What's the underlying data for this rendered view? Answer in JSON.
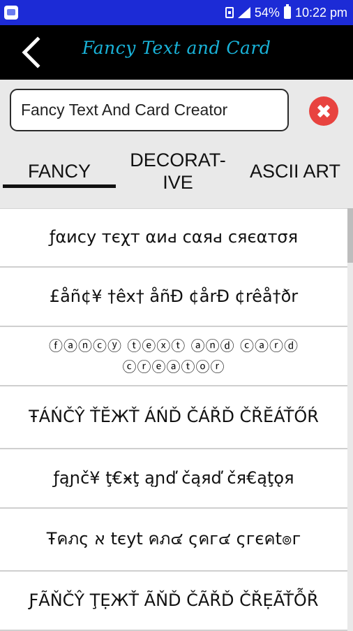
{
  "status_bar": {
    "battery_percent": "54%",
    "time": "10:22 pm",
    "icons": [
      "app-notification-icon",
      "sim-icon",
      "signal-icon",
      "battery-icon"
    ]
  },
  "toolbar": {
    "title": "Fancy Text and Card",
    "back_icon": "chevron-left-icon",
    "background": "#000000",
    "title_color": "#19b3d9"
  },
  "search": {
    "value": "Fancy Text And Card Creator",
    "clear_icon": "close-icon",
    "clear_color": "#e8433f"
  },
  "tabs": [
    {
      "label": "FANCY",
      "selected": true
    },
    {
      "label": "DECORAT-\nIVE",
      "selected": false
    },
    {
      "label": "ASCII ART",
      "selected": false
    }
  ],
  "results": [
    "ƒαиϲу тєχт αиԁ ϲαяԁ ϲяєαтσя",
    "£åñ¢¥ †êx† åñÐ ¢årÐ ¢rêå†ðr",
    "ⓕⓐⓝⓒⓨ ⓣⓔⓧⓣ ⓐⓝⓓ ⓒⓐⓡⓓ ⓒⓡⓔⓐⓣⓞⓡ",
    "ŦÁŃČŶ ŤĔЖŤ ÁŃĎ ČÁŘĎ ČŘĔÁŤŐŔ",
    "ƒąɲč¥ ţ€ӿţ ąɲď čąяď čя€ąţǫя",
    "Ŧคภς א tєyt คภ๔ ςคг๔ ςгєคt๏г",
    "ƑÃŇČŶ ŢẸЖŤ ÃŇĎ ČÃŘĎ ČŘẸÃŤỖŘ"
  ],
  "colors": {
    "status_bar": "#1c2bd6",
    "background": "#e9e9e9"
  }
}
